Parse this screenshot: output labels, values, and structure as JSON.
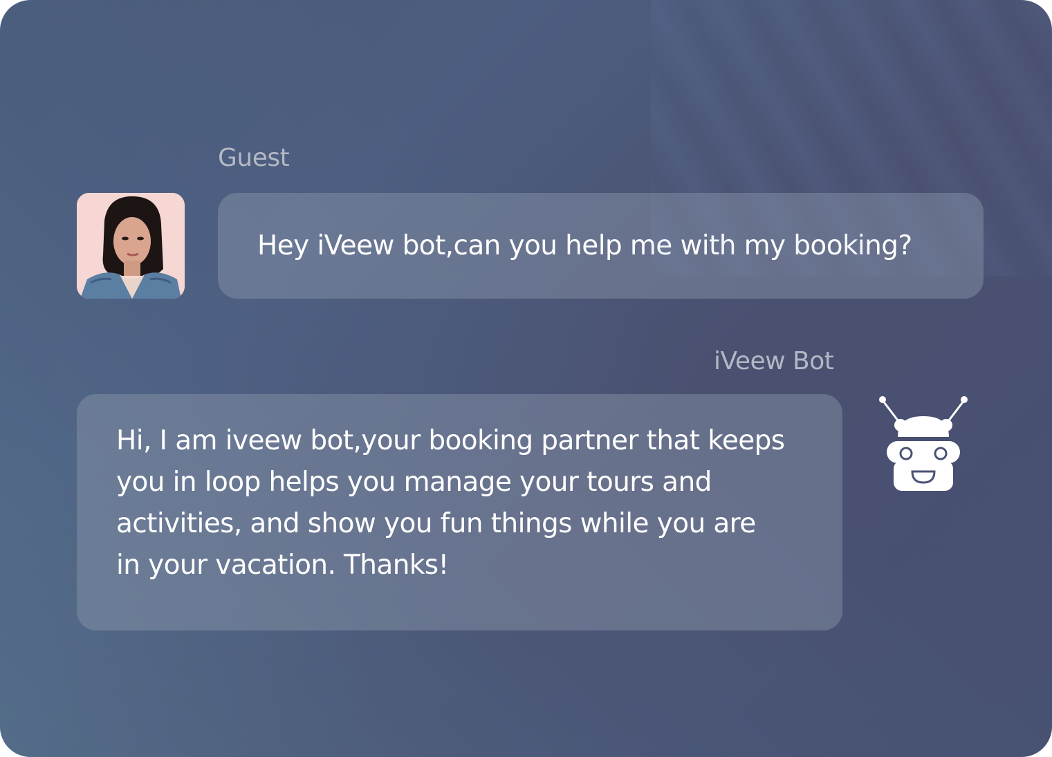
{
  "chat": {
    "guest": {
      "sender_label": "Guest",
      "message": "Hey iVeew bot,can you help me with my booking?"
    },
    "bot": {
      "sender_label": "iVeew Bot",
      "message_lines": [
        "Hi, I am iveew bot,your booking partner that keeps",
        "you in loop helps you manage your tours and",
        "activities, and show you fun things while you are",
        "in your vacation. Thanks!"
      ]
    }
  },
  "icons": {
    "guest_avatar": "user-photo-avatar",
    "bot_avatar": "robot-icon"
  },
  "colors": {
    "bubble": "#7b8499",
    "text": "#ffffff",
    "label": "#b3b8c4"
  }
}
